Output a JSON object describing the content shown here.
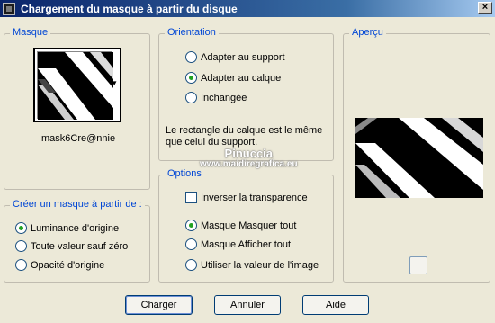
{
  "window": {
    "title": "Chargement du masque à partir du disque",
    "close_label": "×"
  },
  "masque": {
    "legend": "Masque",
    "mask_name": "mask6Cre@nnie"
  },
  "orientation": {
    "legend": "Orientation",
    "options": [
      "Adapter au support",
      "Adapter au calque",
      "Inchangée"
    ],
    "selected": 1,
    "note": "Le rectangle du calque est le même que celui du support."
  },
  "apercu": {
    "legend": "Aperçu"
  },
  "creer": {
    "legend": "Créer un masque à partir de :",
    "options": [
      "Luminance d'origine",
      "Toute valeur sauf zéro",
      "Opacité d'origine"
    ],
    "selected": 0
  },
  "options": {
    "legend": "Options",
    "invert_label": "Inverser la transparence",
    "invert_checked": false,
    "mask_options": [
      "Masque Masquer tout",
      "Masque Afficher tout",
      "Utiliser la valeur de l'image"
    ],
    "selected": 0
  },
  "watermark": {
    "line1": "Pinuccia",
    "line2": "www.maidiregrafica.eu"
  },
  "buttons": {
    "charger": "Charger",
    "annuler": "Annuler",
    "aide": "Aide"
  }
}
